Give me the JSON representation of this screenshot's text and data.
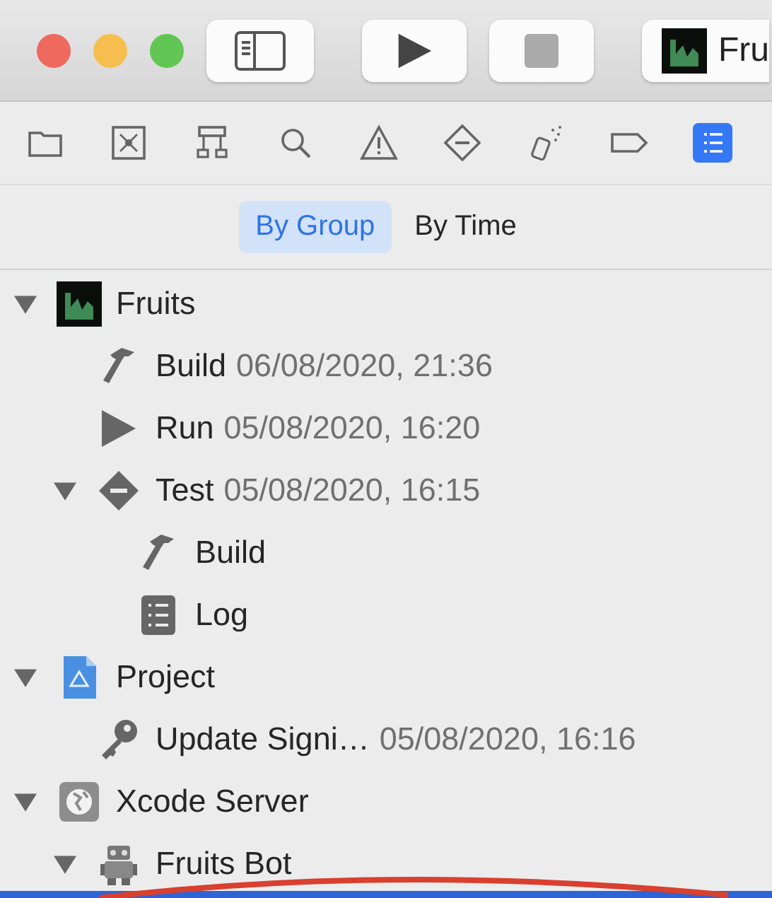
{
  "toolbar": {
    "scheme": {
      "label": "Fru"
    }
  },
  "navigator_tabs": [
    {
      "kind": "folder",
      "selected": false
    },
    {
      "kind": "source-control",
      "selected": false
    },
    {
      "kind": "hierarchy",
      "selected": false
    },
    {
      "kind": "search",
      "selected": false
    },
    {
      "kind": "warning",
      "selected": false
    },
    {
      "kind": "test",
      "selected": false
    },
    {
      "kind": "debug",
      "selected": false
    },
    {
      "kind": "breakpoint",
      "selected": false
    },
    {
      "kind": "report",
      "selected": true
    }
  ],
  "filter": [
    {
      "label": "By Group",
      "selected": true
    },
    {
      "label": "By Time",
      "selected": false
    }
  ],
  "tree": [
    {
      "label": "Fruits",
      "kind": "app",
      "expanded": true,
      "children": [
        {
          "label": "Build",
          "date": "06/08/2020, 21:36",
          "kind": "hammer"
        },
        {
          "label": "Run",
          "date": "05/08/2020, 16:20",
          "kind": "play"
        },
        {
          "label": "Test",
          "date": "05/08/2020, 16:15",
          "kind": "test",
          "expanded": true,
          "children": [
            {
              "label": "Build",
              "kind": "hammer"
            },
            {
              "label": "Log",
              "kind": "log"
            }
          ]
        }
      ]
    },
    {
      "label": "Project",
      "kind": "project",
      "expanded": true,
      "children": [
        {
          "label": "Update Signi…",
          "date": "05/08/2020, 16:16",
          "kind": "key"
        }
      ]
    },
    {
      "label": "Xcode Server",
      "kind": "server",
      "expanded": true,
      "children": [
        {
          "label": "Fruits Bot",
          "kind": "bot",
          "expanded": true
        }
      ]
    }
  ]
}
